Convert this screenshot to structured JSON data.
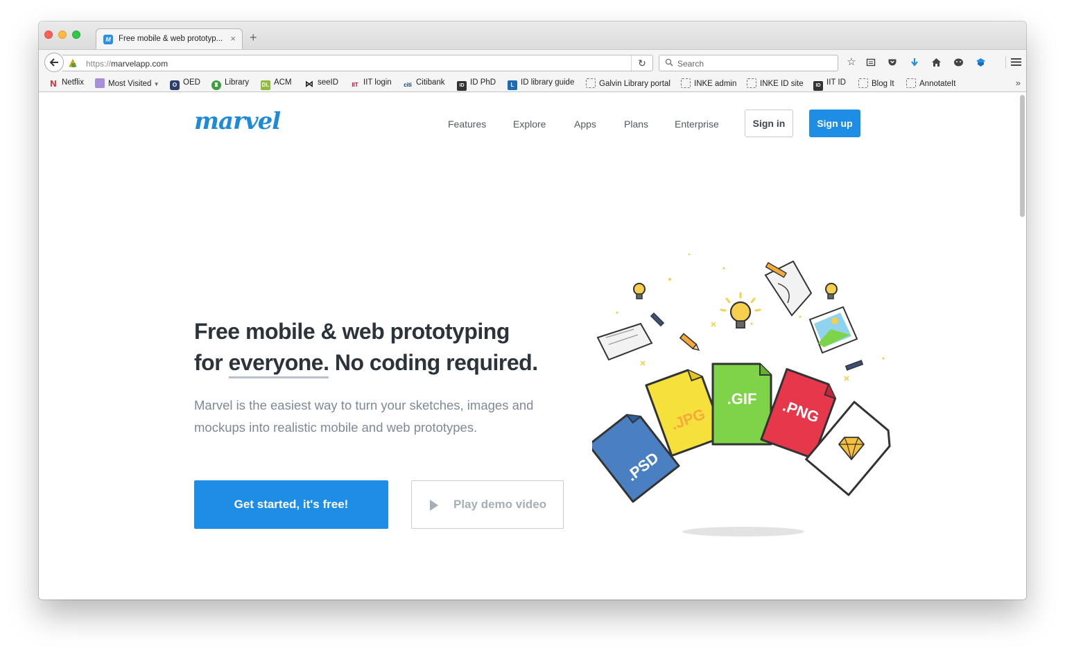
{
  "browser": {
    "tab_title": "Free mobile & web prototyp...",
    "tab_close": "×",
    "new_tab": "+",
    "url_scheme": "https://",
    "url_host": "marvelapp.com",
    "search_placeholder": "Search",
    "bookmarks": [
      "Netflix",
      "Most Visited",
      "OED",
      "Library",
      "ACM",
      "seeID",
      "IIT login",
      "Citibank",
      "ID PhD",
      "ID library guide",
      "Galvin Library portal",
      "INKE admin",
      "INKE ID site",
      "IIT ID",
      "Blog It",
      "AnnotateIt"
    ],
    "overflow": "»"
  },
  "site": {
    "logo": "marvel",
    "nav": [
      "Features",
      "Explore",
      "Apps",
      "Plans",
      "Enterprise"
    ],
    "sign_in": "Sign in",
    "sign_up": "Sign up"
  },
  "hero": {
    "headline_line1": "Free mobile & web prototyping",
    "headline_for": "for ",
    "headline_underlined": "everyone.",
    "headline_rest": " No coding required.",
    "subtext": "Marvel is the easiest way to turn your sketches, images and mockups into realistic mobile and web prototypes.",
    "cta": "Get started, it's free!",
    "demo": "Play demo video"
  },
  "illustration": {
    "files": [
      ".PSD",
      ".JPG",
      ".GIF",
      ".PNG"
    ],
    "colors": {
      "psd": "#4a80c2",
      "jpg": "#f6e03c",
      "gif": "#7ed348",
      "png": "#e7374a",
      "accent": "#1e8de6"
    }
  }
}
